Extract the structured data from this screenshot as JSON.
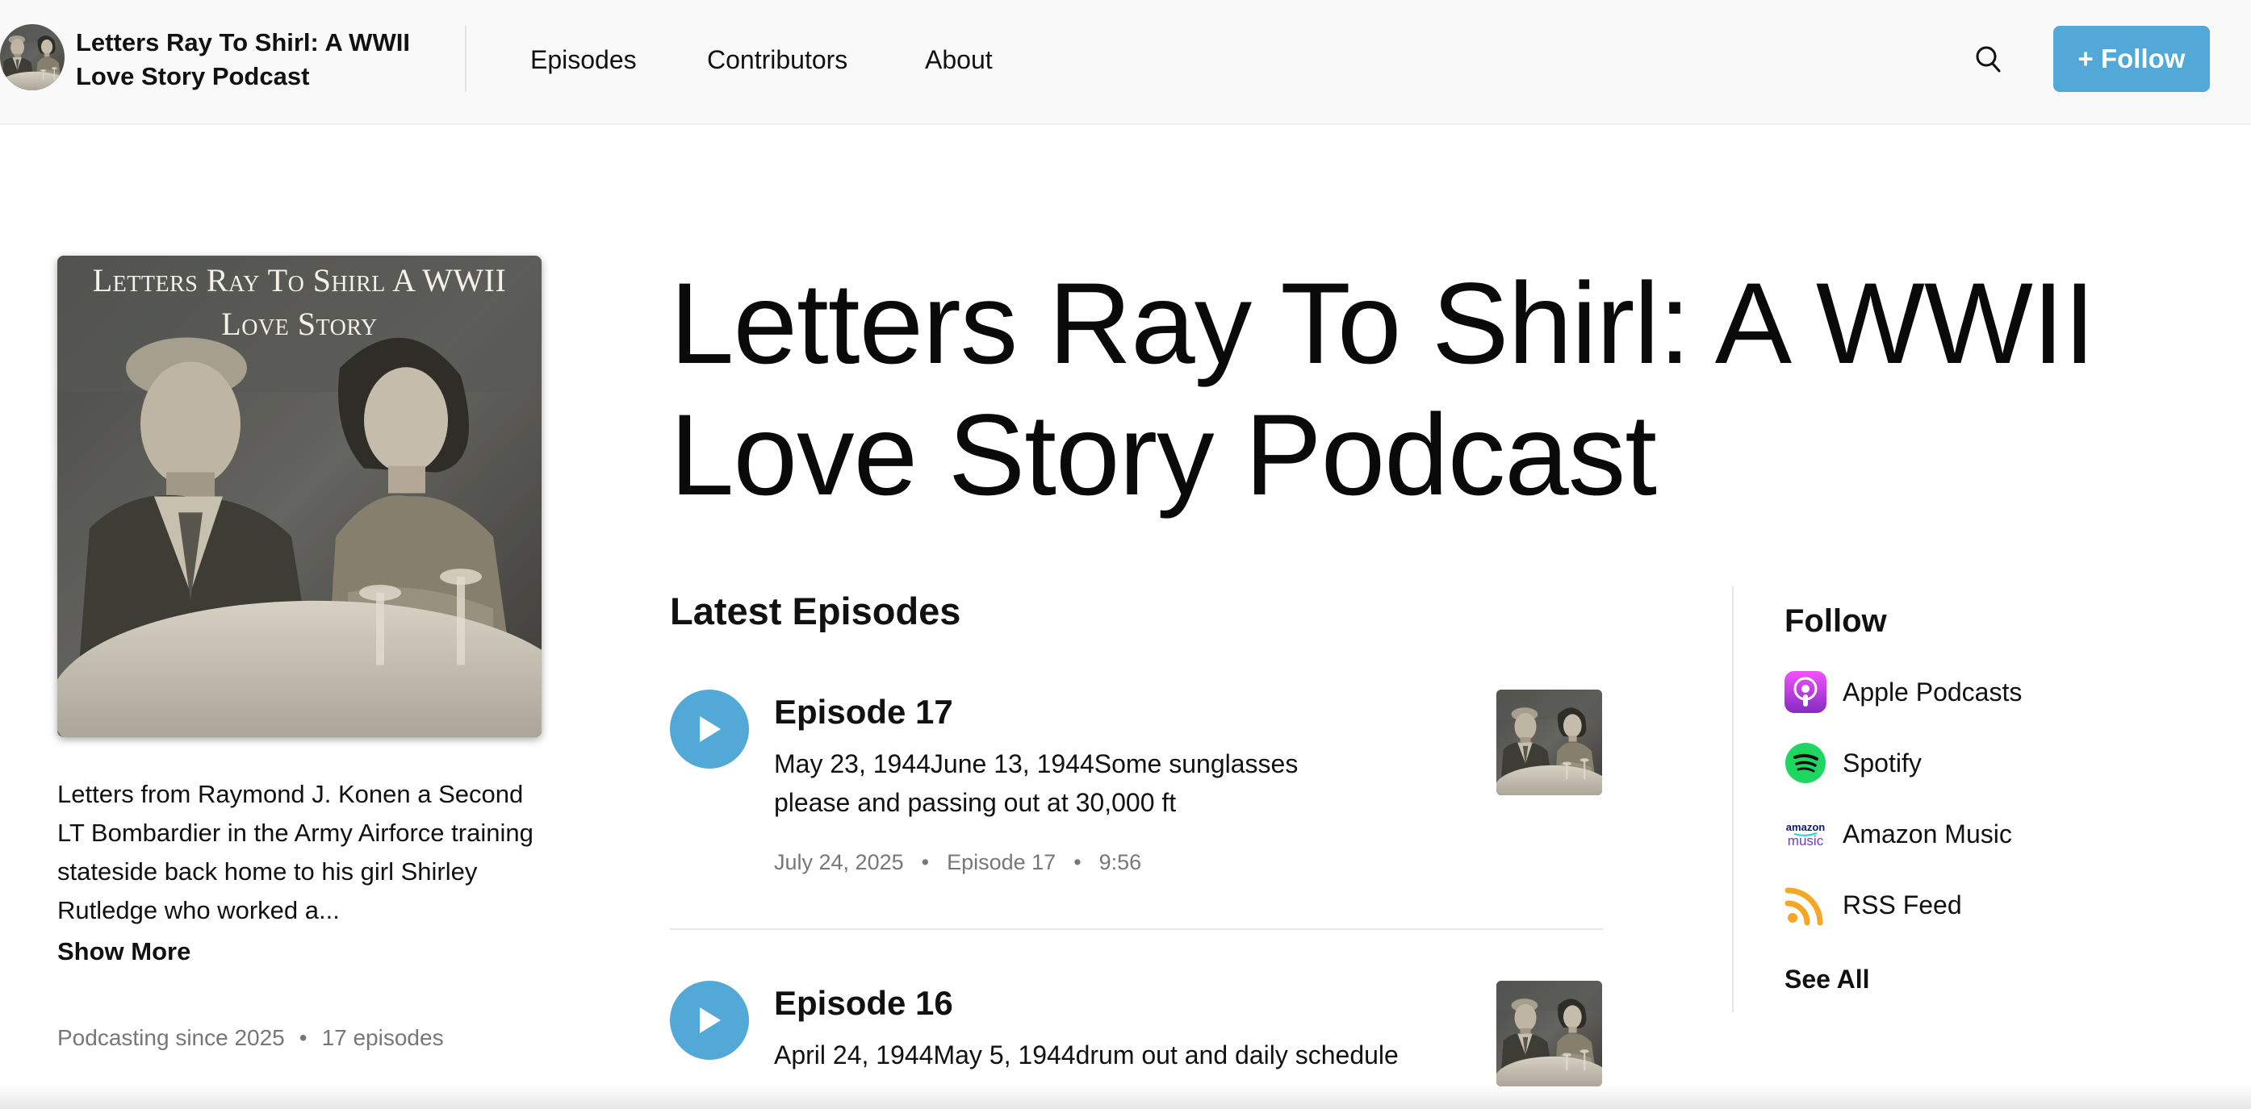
{
  "header": {
    "podcast_title": "Letters Ray To Shirl: A WWII Love Story Podcast",
    "nav": [
      {
        "label": "Episodes"
      },
      {
        "label": "Contributors"
      },
      {
        "label": "About"
      }
    ],
    "search_icon": "search-icon",
    "follow_button": "+ Follow",
    "accent_color": "#52a8d6"
  },
  "cover": {
    "title_text": "Letters Ray To Shirl A WWII Love Story"
  },
  "podcast": {
    "title": "Letters Ray To Shirl: A WWII Love Story Podcast",
    "description": "Letters from Raymond J. Konen a Second LT Bombardier in the Army Airforce training stateside back home to his girl Shirley Rutledge who worked a...",
    "show_more": "Show More",
    "since": "Podcasting since 2025",
    "episode_count": "17 episodes"
  },
  "latest": {
    "heading": "Latest Episodes",
    "episodes": [
      {
        "title": "Episode 17",
        "description": "May 23, 1944June 13, 1944Some sunglasses please and passing out at 30,000 ft",
        "date": "July 24, 2025",
        "number": "Episode 17",
        "duration": "9:56"
      },
      {
        "title": "Episode 16",
        "description": "April 24, 1944May 5, 1944drum out and daily schedule"
      }
    ]
  },
  "follow": {
    "heading": "Follow",
    "platforms": [
      {
        "label": "Apple Podcasts",
        "icon": "apple-podcasts-icon",
        "color": "#b150e2"
      },
      {
        "label": "Spotify",
        "icon": "spotify-icon",
        "color": "#1ed760"
      },
      {
        "label": "Amazon Music",
        "icon": "amazon-music-icon",
        "color": "#25d1da"
      },
      {
        "label": "RSS Feed",
        "icon": "rss-icon",
        "color": "#f5a623"
      }
    ],
    "see_all": "See All"
  }
}
